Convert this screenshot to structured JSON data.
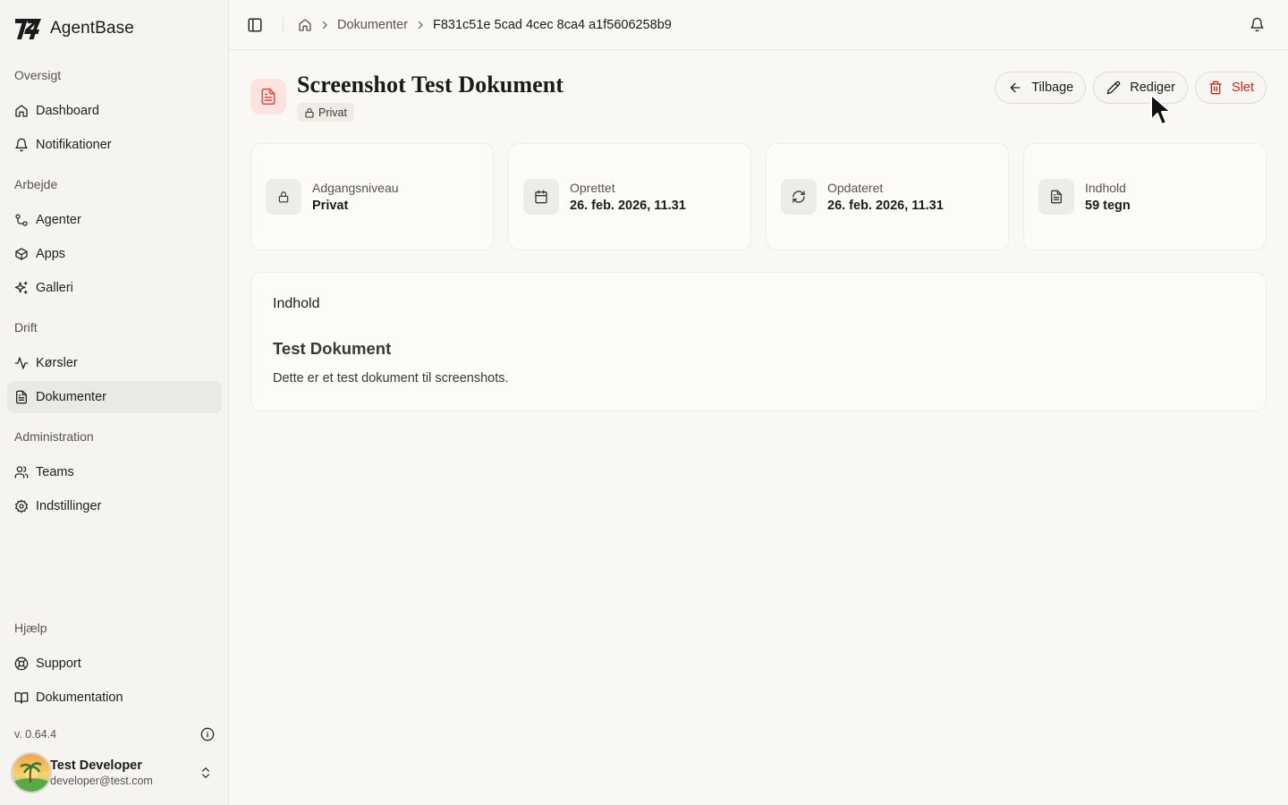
{
  "app": {
    "name": "AgentBase",
    "version": "v. 0.64.4"
  },
  "sidebar": {
    "sections": [
      {
        "heading": "Oversigt",
        "items": [
          {
            "label": "Dashboard",
            "icon": "home-icon"
          },
          {
            "label": "Notifikationer",
            "icon": "bell-icon"
          }
        ]
      },
      {
        "heading": "Arbejde",
        "items": [
          {
            "label": "Agenter",
            "icon": "workflow-icon"
          },
          {
            "label": "Apps",
            "icon": "box-icon"
          },
          {
            "label": "Galleri",
            "icon": "sparkles-icon"
          }
        ]
      },
      {
        "heading": "Drift",
        "items": [
          {
            "label": "Kørsler",
            "icon": "activity-icon"
          },
          {
            "label": "Dokumenter",
            "icon": "file-text-icon",
            "active": true
          }
        ]
      },
      {
        "heading": "Administration",
        "items": [
          {
            "label": "Teams",
            "icon": "users-icon"
          },
          {
            "label": "Indstillinger",
            "icon": "gear-icon"
          }
        ]
      },
      {
        "heading": "Hjælp",
        "items": [
          {
            "label": "Support",
            "icon": "life-buoy-icon"
          },
          {
            "label": "Dokumentation",
            "icon": "book-icon"
          }
        ]
      }
    ],
    "user": {
      "name": "Test Developer",
      "email": "developer@test.com"
    }
  },
  "topbar": {
    "breadcrumb": {
      "parent": "Dokumenter",
      "current": "F831c51e 5cad 4cec 8ca4 a1f5606258b9"
    }
  },
  "page": {
    "title": "Screenshot Test Dokument",
    "badge": "Privat",
    "actions": {
      "back": "Tilbage",
      "edit": "Rediger",
      "delete": "Slet"
    }
  },
  "stats": [
    {
      "label": "Adgangsniveau",
      "value": "Privat",
      "icon": "lock-icon"
    },
    {
      "label": "Oprettet",
      "value": "26. feb. 2026, 11.31",
      "icon": "calendar-icon"
    },
    {
      "label": "Opdateret",
      "value": "26. feb. 2026, 11.31",
      "icon": "refresh-icon"
    },
    {
      "label": "Indhold",
      "value": "59 tegn",
      "icon": "file-text-icon"
    }
  ],
  "content": {
    "heading": "Indhold",
    "doc_heading": "Test Dokument",
    "doc_body": "Dette er et test dokument til screenshots."
  },
  "colors": {
    "accent_danger": "#d8201a",
    "doc_icon": "#e0544b",
    "active_nav": "#ebe9e5"
  }
}
